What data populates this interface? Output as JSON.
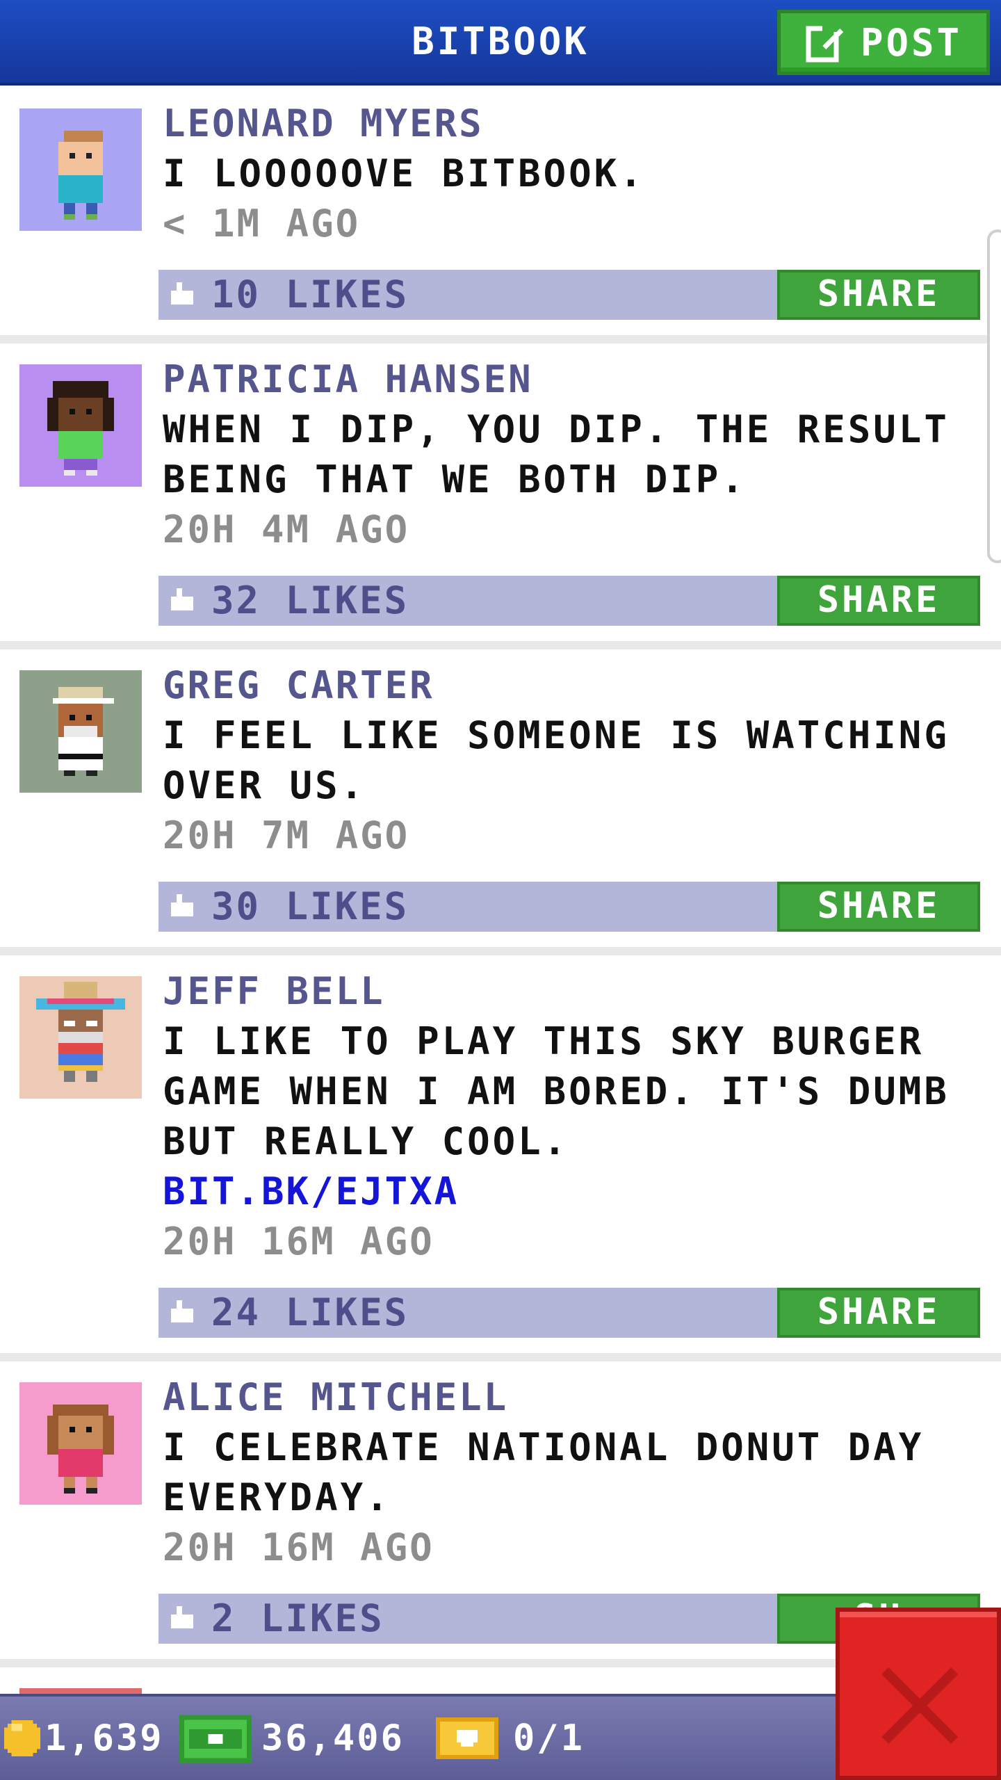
{
  "header": {
    "title": "BITBOOK",
    "post_label": "POST"
  },
  "posts": [
    {
      "author": "LEONARD MYERS",
      "body": "I LOOOOOVE BITBOOK.",
      "time": "< 1M AGO",
      "likes": "10 LIKES",
      "share": "SHARE"
    },
    {
      "author": "PATRICIA HANSEN",
      "body": "WHEN I DIP, YOU DIP. THE RESULT BEING THAT WE BOTH DIP.",
      "time": "20H 4M AGO",
      "likes": "32 LIKES",
      "share": "SHARE"
    },
    {
      "author": "GREG CARTER",
      "body": "I FEEL LIKE SOMEONE IS WATCHING OVER US.",
      "time": "20H 7M AGO",
      "likes": "30 LIKES",
      "share": "SHARE"
    },
    {
      "author": "JEFF BELL",
      "body": "I LIKE TO PLAY THIS SKY BURGER GAME WHEN I AM BORED. IT'S DUMB BUT REALLY COOL.",
      "link": "BIT.BK/EJTXA",
      "time": "20H 16M AGO",
      "likes": "24 LIKES",
      "share": "SHARE"
    },
    {
      "author": "ALICE MITCHELL",
      "body": "I CELEBRATE NATIONAL DONUT DAY EVERYDAY.",
      "time": "20H 16M AGO",
      "likes": "2 LIKES",
      "share": "SH"
    }
  ],
  "bottom_bar": {
    "coins": "1,639",
    "bux": "36,406",
    "tickets": "0/1"
  },
  "colors": {
    "header": "#1d4ec4",
    "accent_green": "#3fa43b",
    "like_bar": "#b4b6d9",
    "close_red": "#e02424"
  },
  "icons": [
    "edit-icon",
    "thumbs-up-icon",
    "coin-icon",
    "bux-icon",
    "ticket-icon",
    "close-icon"
  ]
}
